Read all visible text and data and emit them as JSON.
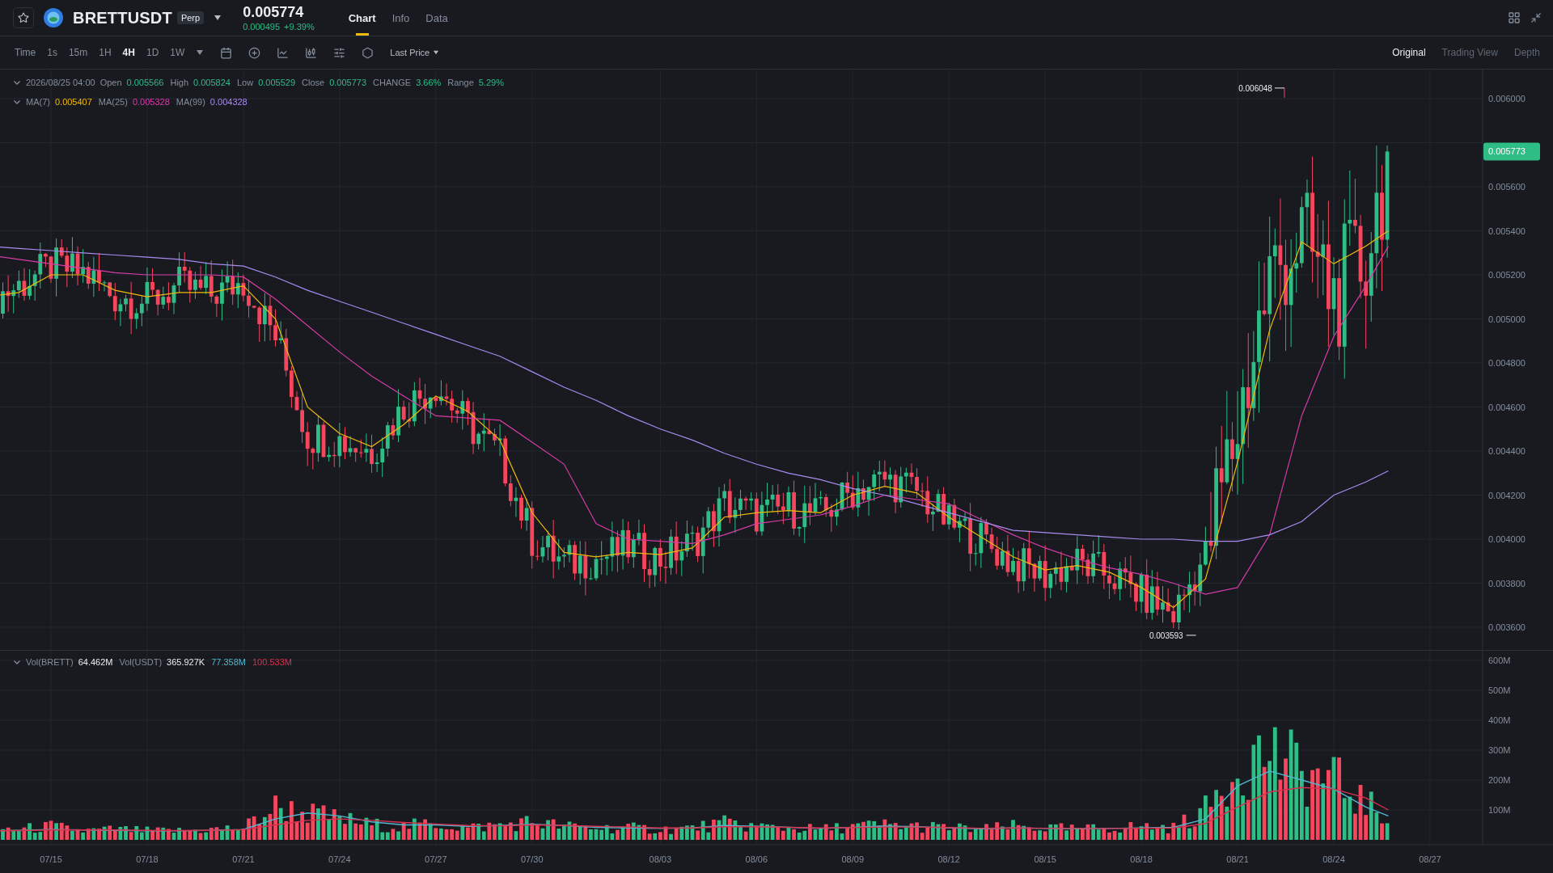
{
  "header": {
    "symbol": "BRETTUSDT",
    "badge": "Perp",
    "price": "0.005774",
    "change": "0.000495",
    "change_pct": "+9.39%",
    "tabs": [
      {
        "label": "Chart",
        "selected": true
      },
      {
        "label": "Info",
        "selected": false
      },
      {
        "label": "Data",
        "selected": false
      }
    ]
  },
  "toolbar": {
    "intervals": [
      {
        "label": "Time",
        "selected": false
      },
      {
        "label": "1s",
        "selected": false
      },
      {
        "label": "15m",
        "selected": false
      },
      {
        "label": "1H",
        "selected": false
      },
      {
        "label": "4H",
        "selected": true
      },
      {
        "label": "1D",
        "selected": false
      },
      {
        "label": "1W",
        "selected": false
      }
    ],
    "price_type": "Last Price",
    "views": [
      {
        "label": "Original",
        "selected": true
      },
      {
        "label": "Trading View",
        "selected": false
      },
      {
        "label": "Depth",
        "selected": false
      }
    ]
  },
  "price_chart": {
    "timestamp": "2026/08/25 04:00",
    "ohlc": [
      {
        "label": "Open",
        "value": "0.005566"
      },
      {
        "label": "High",
        "value": "0.005824"
      },
      {
        "label": "Low",
        "value": "0.005529"
      },
      {
        "label": "Close",
        "value": "0.005773"
      },
      {
        "label": "CHANGE",
        "value": "3.66%"
      },
      {
        "label": "Range",
        "value": "5.29%"
      }
    ],
    "ma": [
      {
        "label": "MA(7)",
        "value": "0.005407",
        "color": "#f0b90b"
      },
      {
        "label": "MA(25)",
        "value": "0.005328",
        "color": "#d63ba8"
      },
      {
        "label": "MA(99)",
        "value": "0.004328",
        "color": "#a98bf0"
      }
    ],
    "high_label": "0.006048",
    "low_label": "0.003593",
    "current_price": "0.005773",
    "axis_labels": [
      "0.006000",
      "0.005600",
      "0.005400",
      "0.005200",
      "0.005000",
      "0.004800",
      "0.004600",
      "0.004400",
      "0.004200",
      "0.004000",
      "0.003800",
      "0.003600"
    ]
  },
  "volume_chart": {
    "legend": [
      {
        "label": "Vol(BRETT)",
        "value": "64.462M",
        "color": "#eaecef"
      },
      {
        "label": "Vol(USDT)",
        "value": "365.927K",
        "color": "#eaecef"
      },
      {
        "value": "77.358M",
        "color": "#50b8d0"
      },
      {
        "value": "100.533M",
        "color": "#d9304e"
      }
    ],
    "axis_labels": [
      "600M",
      "500M",
      "400M",
      "300M",
      "200M",
      "100M"
    ]
  },
  "date_axis": [
    "07/15",
    "07/18",
    "07/21",
    "07/24",
    "07/27",
    "07/30",
    "08/03",
    "08/06",
    "08/09",
    "08/12",
    "08/15",
    "08/18",
    "08/21",
    "08/24",
    "08/27"
  ]
}
